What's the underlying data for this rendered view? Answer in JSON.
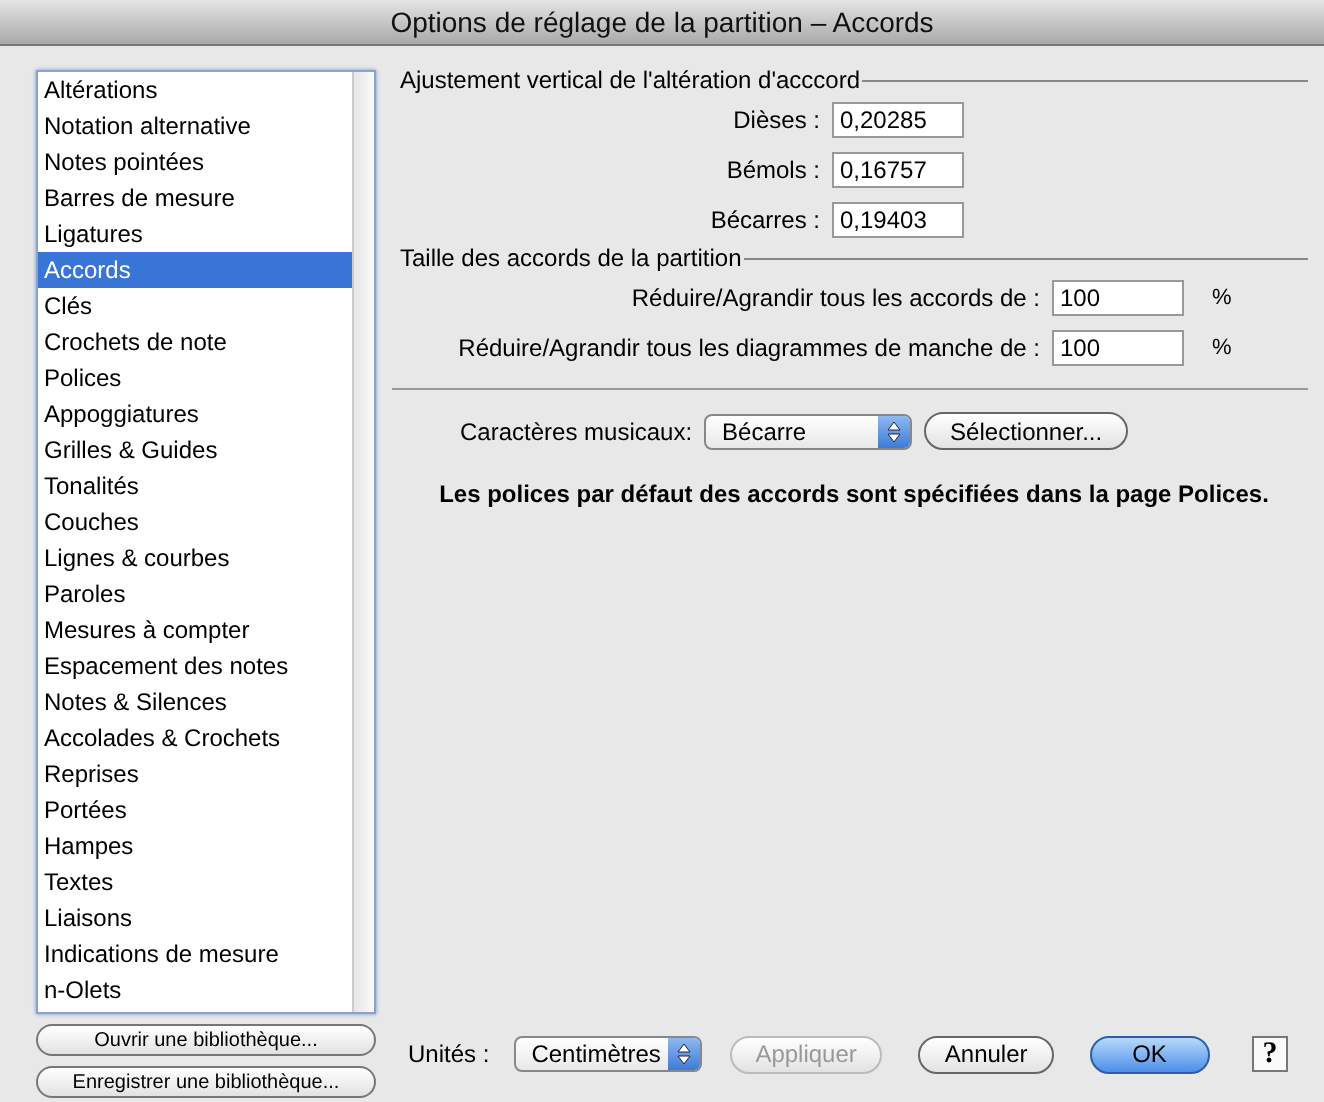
{
  "window": {
    "title": "Options de réglage de la partition – Accords"
  },
  "sidebar": {
    "items": [
      {
        "label": "Altérations",
        "selected": false
      },
      {
        "label": "Notation alternative",
        "selected": false
      },
      {
        "label": "Notes pointées",
        "selected": false
      },
      {
        "label": "Barres de mesure",
        "selected": false
      },
      {
        "label": "Ligatures",
        "selected": false
      },
      {
        "label": "Accords",
        "selected": true
      },
      {
        "label": "Clés",
        "selected": false
      },
      {
        "label": "Crochets de note",
        "selected": false
      },
      {
        "label": "Polices",
        "selected": false
      },
      {
        "label": "Appoggiatures",
        "selected": false
      },
      {
        "label": "Grilles & Guides",
        "selected": false
      },
      {
        "label": "Tonalités",
        "selected": false
      },
      {
        "label": "Couches",
        "selected": false
      },
      {
        "label": "Lignes & courbes",
        "selected": false
      },
      {
        "label": "Paroles",
        "selected": false
      },
      {
        "label": "Mesures à compter",
        "selected": false
      },
      {
        "label": "Espacement des notes",
        "selected": false
      },
      {
        "label": "Notes & Silences",
        "selected": false
      },
      {
        "label": "Accolades & Crochets",
        "selected": false
      },
      {
        "label": "Reprises",
        "selected": false
      },
      {
        "label": "Portées",
        "selected": false
      },
      {
        "label": "Hampes",
        "selected": false
      },
      {
        "label": "Textes",
        "selected": false
      },
      {
        "label": "Liaisons",
        "selected": false
      },
      {
        "label": "Indications de mesure",
        "selected": false
      },
      {
        "label": "n-Olets",
        "selected": false
      }
    ],
    "buttons": [
      "Ouvrir une bibliothèque...",
      "Enregistrer une bibliothèque..."
    ]
  },
  "vertical_adjust": {
    "title": "Ajustement vertical de l'altération d'acccord",
    "fields": [
      {
        "label": "Dièses :",
        "value": "0,20285"
      },
      {
        "label": "Bémols :",
        "value": "0,16757"
      },
      {
        "label": "Bécarres :",
        "value": "0,19403"
      }
    ]
  },
  "size": {
    "title": "Taille des accords de la partition",
    "fields": [
      {
        "label": "Réduire/Agrandir tous les accords de :",
        "value": "100",
        "unit": "%"
      },
      {
        "label": "Réduire/Agrandir tous les diagrammes de manche de :",
        "value": "100",
        "unit": "%"
      }
    ]
  },
  "music_chars": {
    "label": "Caractères musicaux:",
    "value": "Bécarre",
    "button": "Sélectionner..."
  },
  "note": "Les polices par défaut des accords sont spécifiées dans la page Polices.",
  "footer": {
    "units_label": "Unités :",
    "units_value": "Centimètres",
    "buttons": [
      {
        "label": "Appliquer",
        "disabled": true,
        "default": false
      },
      {
        "label": "Annuler",
        "disabled": false,
        "default": false
      },
      {
        "label": "OK",
        "disabled": false,
        "default": true
      }
    ],
    "help": "?"
  }
}
